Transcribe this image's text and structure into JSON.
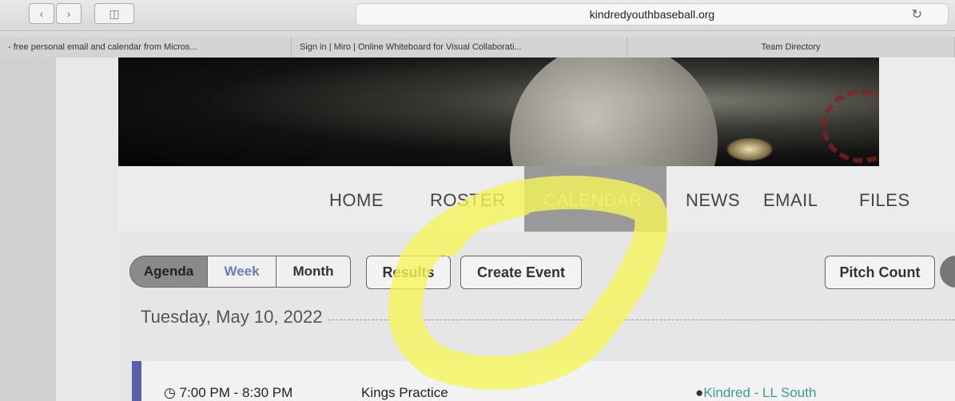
{
  "browser": {
    "url": "kindredyouthbaseball.org",
    "bookmarks": [
      "- free personal email and calendar from Micros...",
      "Sign in | Miro | Online Whiteboard for Visual Collaborati...",
      "Team Directory"
    ]
  },
  "nav": {
    "items": [
      "HOME",
      "ROSTER",
      "CALENDAR",
      "NEWS",
      "EMAIL",
      "FILES"
    ],
    "active": "CALENDAR"
  },
  "calendar": {
    "view_tabs": [
      "Agenda",
      "Week",
      "Month"
    ],
    "active_view": "Agenda",
    "results_label": "Results",
    "create_event_label": "Create Event",
    "pitch_count_label": "Pitch Count",
    "date_heading": "Tuesday, May 10, 2022",
    "events": [
      {
        "time": "7:00 PM - 8:30 PM",
        "title": "Kings Practice",
        "location": "Kindred - LL South"
      }
    ]
  },
  "colors": {
    "annotation": "#f5f55a",
    "event_accent": "#5a5fa8",
    "location_link": "#3d9a92"
  }
}
